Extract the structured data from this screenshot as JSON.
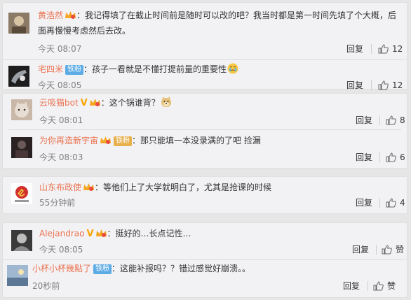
{
  "comments": [
    {
      "user": "黄浩然",
      "text": "我记得填了在截止时间前是随时可以改的吧？我当时都是第一时间先填了个大概，后面再慢慢考虑然后去改。",
      "time": "今天 08:07",
      "reply": "回复",
      "likes": "12"
    },
    {
      "user": "宅四米",
      "fan_badge": "铁粉",
      "text": "孩子一看就是不懂打提前量的重要性",
      "time": "今天 08:05",
      "reply": "回复",
      "likes": "12"
    },
    {
      "user": "云吸猫bot",
      "verified": "V",
      "text": "这个锅谁背？",
      "time": "今天 08:01",
      "reply": "回复",
      "likes": "8"
    },
    {
      "user": "为你再造新宇宙",
      "fan_badge": "铁粉",
      "text": "那只能填一本没录满的了吧 捡漏",
      "time": "今天 08:03",
      "reply": "回复",
      "likes": "6"
    },
    {
      "user": "山东布政使",
      "text": "等他们上了大学就明白了，尤其是抢课的时候",
      "time": "55分钟前",
      "reply": "回复",
      "likes": "4"
    },
    {
      "user": "Alejandrao",
      "verified": "V",
      "text": "挺好的…长点记性…",
      "time": "今天 08:05",
      "reply": "回复",
      "likes": "赞"
    },
    {
      "user": "小杯小杯幾點了",
      "fan_badge": "铁粉",
      "text": "这能补报吗？？错过感觉好崩溃。。",
      "time": "20秒前",
      "reply": "回复",
      "likes": "赞"
    }
  ],
  "colors": {
    "username": "#eb7350",
    "background": "#e6e6e6",
    "card": "#f2f2f5",
    "fan_badge": "#5cabe5",
    "verified": "#f8a400"
  },
  "icons": {
    "like": "thumbs-up-icon",
    "level": "level-crown-icon",
    "emoji_cry": "crying-face-emoji",
    "emoji_doge": "doge-emoji"
  }
}
